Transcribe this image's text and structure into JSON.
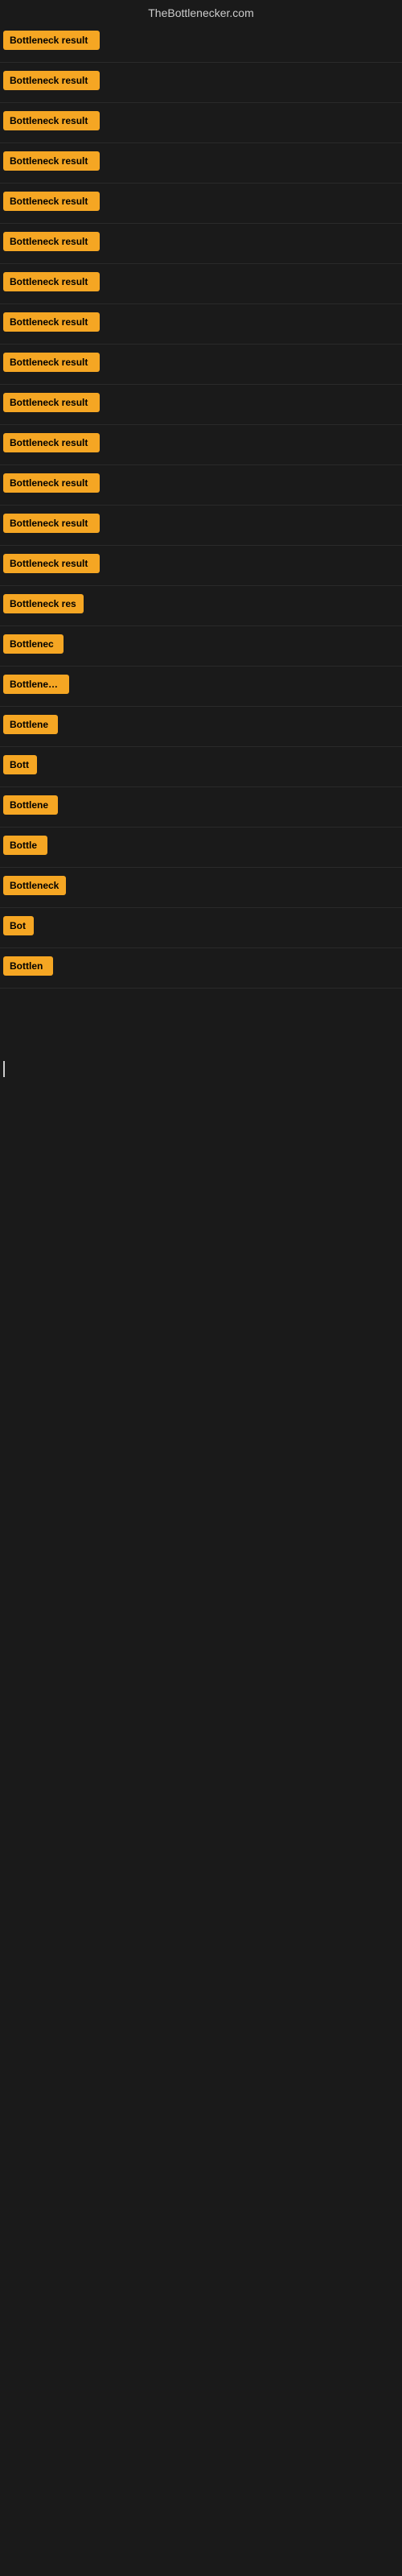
{
  "header": {
    "title": "TheBottlenecker.com"
  },
  "buttons": [
    {
      "id": 1,
      "label": "Bottleneck result",
      "width": 120
    },
    {
      "id": 2,
      "label": "Bottleneck result",
      "width": 120
    },
    {
      "id": 3,
      "label": "Bottleneck result",
      "width": 120
    },
    {
      "id": 4,
      "label": "Bottleneck result",
      "width": 120
    },
    {
      "id": 5,
      "label": "Bottleneck result",
      "width": 120
    },
    {
      "id": 6,
      "label": "Bottleneck result",
      "width": 120
    },
    {
      "id": 7,
      "label": "Bottleneck result",
      "width": 120
    },
    {
      "id": 8,
      "label": "Bottleneck result",
      "width": 120
    },
    {
      "id": 9,
      "label": "Bottleneck result",
      "width": 120
    },
    {
      "id": 10,
      "label": "Bottleneck result",
      "width": 120
    },
    {
      "id": 11,
      "label": "Bottleneck result",
      "width": 120
    },
    {
      "id": 12,
      "label": "Bottleneck result",
      "width": 120
    },
    {
      "id": 13,
      "label": "Bottleneck result",
      "width": 120
    },
    {
      "id": 14,
      "label": "Bottleneck result",
      "width": 120
    },
    {
      "id": 15,
      "label": "Bottleneck res",
      "width": 100
    },
    {
      "id": 16,
      "label": "Bottlenec",
      "width": 75
    },
    {
      "id": 17,
      "label": "Bottleneck r",
      "width": 82
    },
    {
      "id": 18,
      "label": "Bottlene",
      "width": 68
    },
    {
      "id": 19,
      "label": "Bott",
      "width": 42
    },
    {
      "id": 20,
      "label": "Bottlene",
      "width": 68
    },
    {
      "id": 21,
      "label": "Bottle",
      "width": 55
    },
    {
      "id": 22,
      "label": "Bottleneck",
      "width": 78
    },
    {
      "id": 23,
      "label": "Bot",
      "width": 38
    },
    {
      "id": 24,
      "label": "Bottlen",
      "width": 62
    }
  ],
  "colors": {
    "button_bg": "#f5a623",
    "button_text": "#000000",
    "page_bg": "#1a1a1a",
    "header_text": "#cccccc",
    "cursor": "#cccccc"
  }
}
